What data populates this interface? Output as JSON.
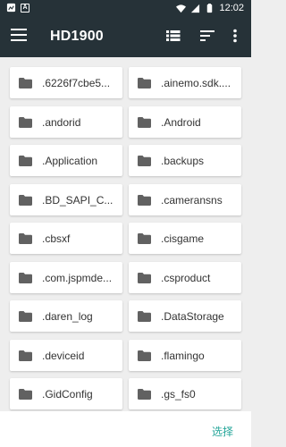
{
  "status_bar": {
    "time": "12:02",
    "left_icons": [
      "notification-icon",
      "a-icon"
    ],
    "right_icons": [
      "wifi-icon",
      "signal-icon",
      "battery-icon"
    ]
  },
  "app_bar": {
    "title": "HD1900",
    "actions": [
      "view-list-icon",
      "sort-icon",
      "more-vert-icon"
    ]
  },
  "folders": [
    {
      "name": ".6226f7cbe5..."
    },
    {
      "name": ".ainemo.sdk...."
    },
    {
      "name": ".andorid"
    },
    {
      "name": ".Android"
    },
    {
      "name": ".Application"
    },
    {
      "name": ".backups"
    },
    {
      "name": ".BD_SAPI_C..."
    },
    {
      "name": ".cameransns"
    },
    {
      "name": ".cbsxf"
    },
    {
      "name": ".cisgame"
    },
    {
      "name": ".com.jspmde..."
    },
    {
      "name": ".csproduct"
    },
    {
      "name": ".daren_log"
    },
    {
      "name": ".DataStorage"
    },
    {
      "name": ".deviceid"
    },
    {
      "name": ".flamingo"
    },
    {
      "name": ".GidConfig"
    },
    {
      "name": ".gs_fs0"
    }
  ],
  "bottom_bar": {
    "select_label": "选择"
  },
  "colors": {
    "app_bar": "#263238",
    "folder_icon": "#616161",
    "accent": "#26a69a",
    "background": "#eeeeee"
  }
}
